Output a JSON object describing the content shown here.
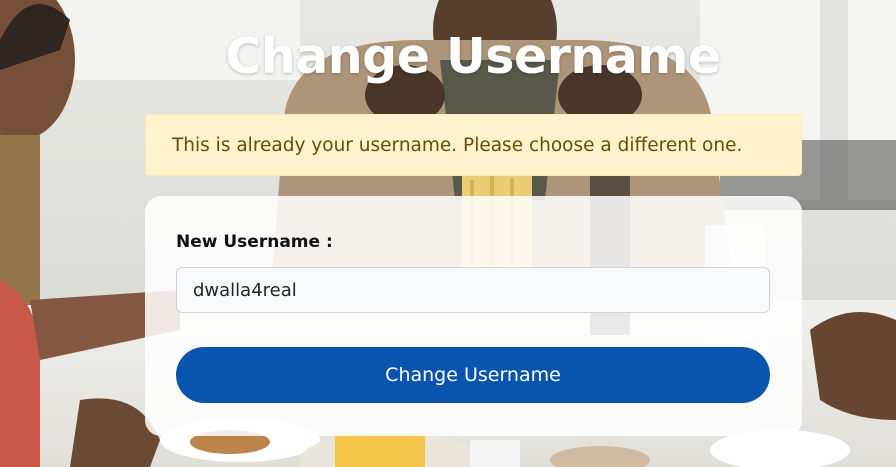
{
  "page": {
    "title": "Change Username"
  },
  "alert": {
    "message": "This is already your username. Please choose a different one.",
    "color": "#664d03",
    "background": "#fff3cd"
  },
  "form": {
    "username_label": "New Username :",
    "username_value": "dwalla4real",
    "submit_label": "Change Username",
    "submit_color": "#0854ae"
  }
}
